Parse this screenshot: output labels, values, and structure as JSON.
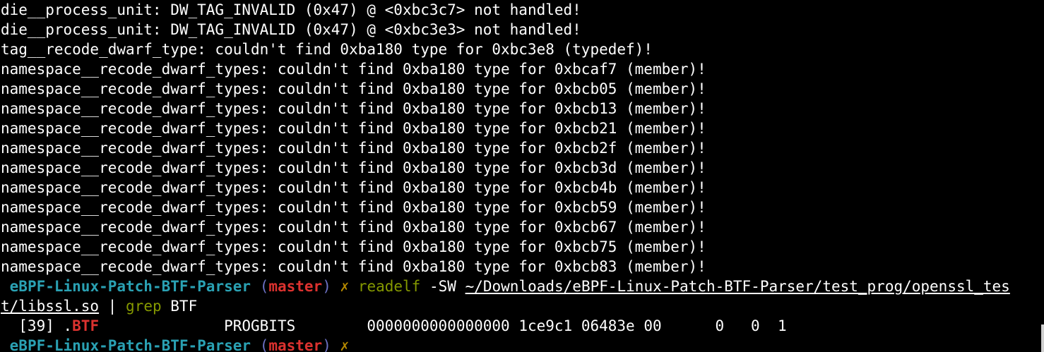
{
  "log_lines": [
    "die__process_unit: DW_TAG_INVALID (0x47) @ <0xbc3c7> not handled!",
    "die__process_unit: DW_TAG_INVALID (0x47) @ <0xbc3e3> not handled!",
    "tag__recode_dwarf_type: couldn't find 0xba180 type for 0xbc3e8 (typedef)!",
    "namespace__recode_dwarf_types: couldn't find 0xba180 type for 0xbcaf7 (member)!",
    "namespace__recode_dwarf_types: couldn't find 0xba180 type for 0xbcb05 (member)!",
    "namespace__recode_dwarf_types: couldn't find 0xba180 type for 0xbcb13 (member)!",
    "namespace__recode_dwarf_types: couldn't find 0xba180 type for 0xbcb21 (member)!",
    "namespace__recode_dwarf_types: couldn't find 0xba180 type for 0xbcb2f (member)!",
    "namespace__recode_dwarf_types: couldn't find 0xba180 type for 0xbcb3d (member)!",
    "namespace__recode_dwarf_types: couldn't find 0xba180 type for 0xbcb4b (member)!",
    "namespace__recode_dwarf_types: couldn't find 0xba180 type for 0xbcb59 (member)!",
    "namespace__recode_dwarf_types: couldn't find 0xba180 type for 0xbcb67 (member)!",
    "namespace__recode_dwarf_types: couldn't find 0xba180 type for 0xbcb75 (member)!",
    "namespace__recode_dwarf_types: couldn't find 0xba180 type for 0xbcb83 (member)!"
  ],
  "prompt1": {
    "dir": "eBPF-Linux-Patch-BTF-Parser",
    "paren_open": "(",
    "branch": "master",
    "paren_close": ")",
    "status": "✗",
    "command": "readelf",
    "args": "-SW",
    "path_part1": "~/Downloads/eBPF-Linux-Patch-BTF-Parser/test_prog/openssl_tes",
    "path_part2": "t/libssl.so",
    "pipe": "|",
    "command2": "grep",
    "args2": "BTF"
  },
  "output": {
    "prefix": "  [39] .",
    "match": "BTF",
    "rest": "              PROGBITS        0000000000000000 1ce9c1 06483e 00      0   0  1"
  },
  "prompt2": {
    "dir": "eBPF-Linux-Patch-BTF-Parser",
    "paren_open": "(",
    "branch": "master",
    "paren_close": ")",
    "status": "✗"
  },
  "colors": {
    "background": "#000000",
    "text": "#ffffff",
    "dir": "#2aa1b3",
    "branch": "#dc322f",
    "command": "#859900",
    "status": "#b58900"
  }
}
